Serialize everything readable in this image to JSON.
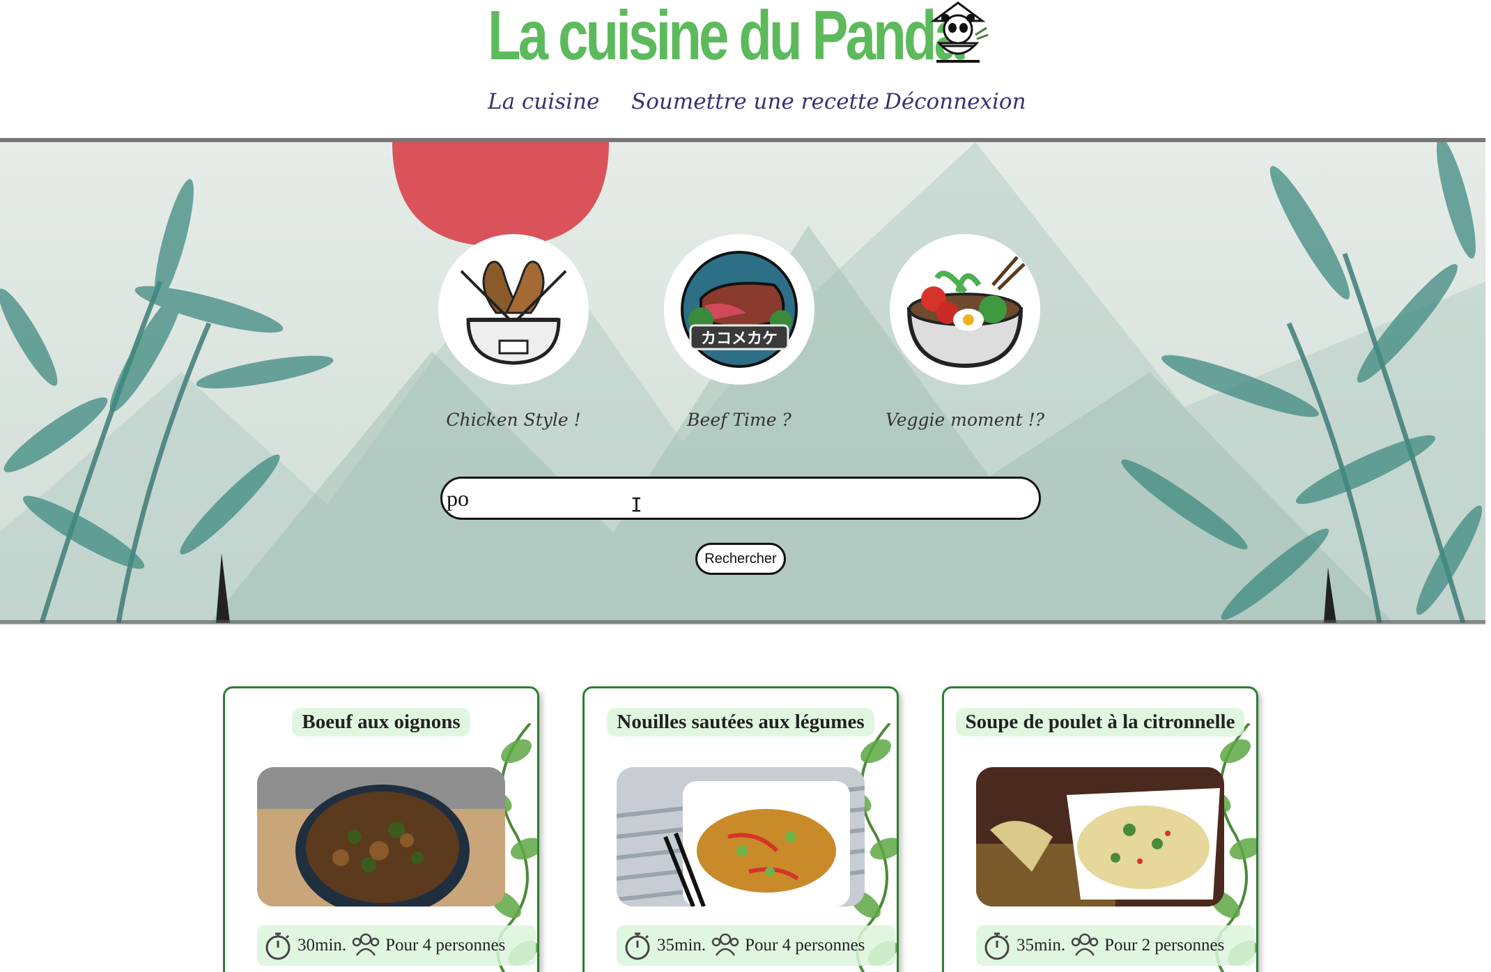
{
  "header": {
    "title": "La cuisine du Panda",
    "nav": [
      {
        "label": "La cuisine"
      },
      {
        "label": "Soumettre une recette"
      },
      {
        "label": "Déconnexion"
      }
    ]
  },
  "hero": {
    "categories": [
      {
        "label": "Chicken Style !",
        "icon": "chicken-bowl-icon"
      },
      {
        "label": "Beef Time ?",
        "icon": "beef-icon",
        "badge_text": "カコメカケ"
      },
      {
        "label": "Veggie moment !?",
        "icon": "veggie-bowl-icon"
      }
    ],
    "search": {
      "value": "po",
      "button_label": "Rechercher"
    }
  },
  "recipes": [
    {
      "title": "Boeuf aux oignons",
      "time": "30min.",
      "servings": "Pour 4 personnes"
    },
    {
      "title": "Nouilles sautées aux légumes",
      "time": "35min.",
      "servings": "Pour 4 personnes"
    },
    {
      "title": "Soupe de poulet à la citronnelle",
      "time": "35min.",
      "servings": "Pour 2 personnes"
    }
  ],
  "colors": {
    "title_green": "#5cba5c",
    "nav_purple": "#3b2f73",
    "card_border": "#2e7d32",
    "sun_red": "#d9424a"
  }
}
